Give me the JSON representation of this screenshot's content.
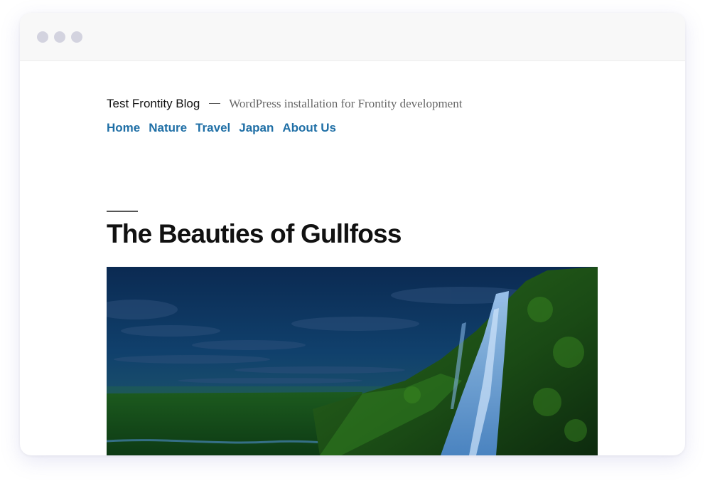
{
  "site": {
    "title": "Test Frontity Blog",
    "description": "WordPress installation for Frontity development"
  },
  "nav": {
    "items": [
      {
        "label": "Home"
      },
      {
        "label": "Nature"
      },
      {
        "label": "Travel"
      },
      {
        "label": "Japan"
      },
      {
        "label": "About Us"
      }
    ]
  },
  "post": {
    "title": "The Beauties of Gullfoss",
    "image_subject": "waterfall-landscape"
  },
  "colors": {
    "link": "#1f6fa6",
    "title_text": "#111111",
    "description_text": "#666666",
    "window_dots": "#d3d3df"
  }
}
